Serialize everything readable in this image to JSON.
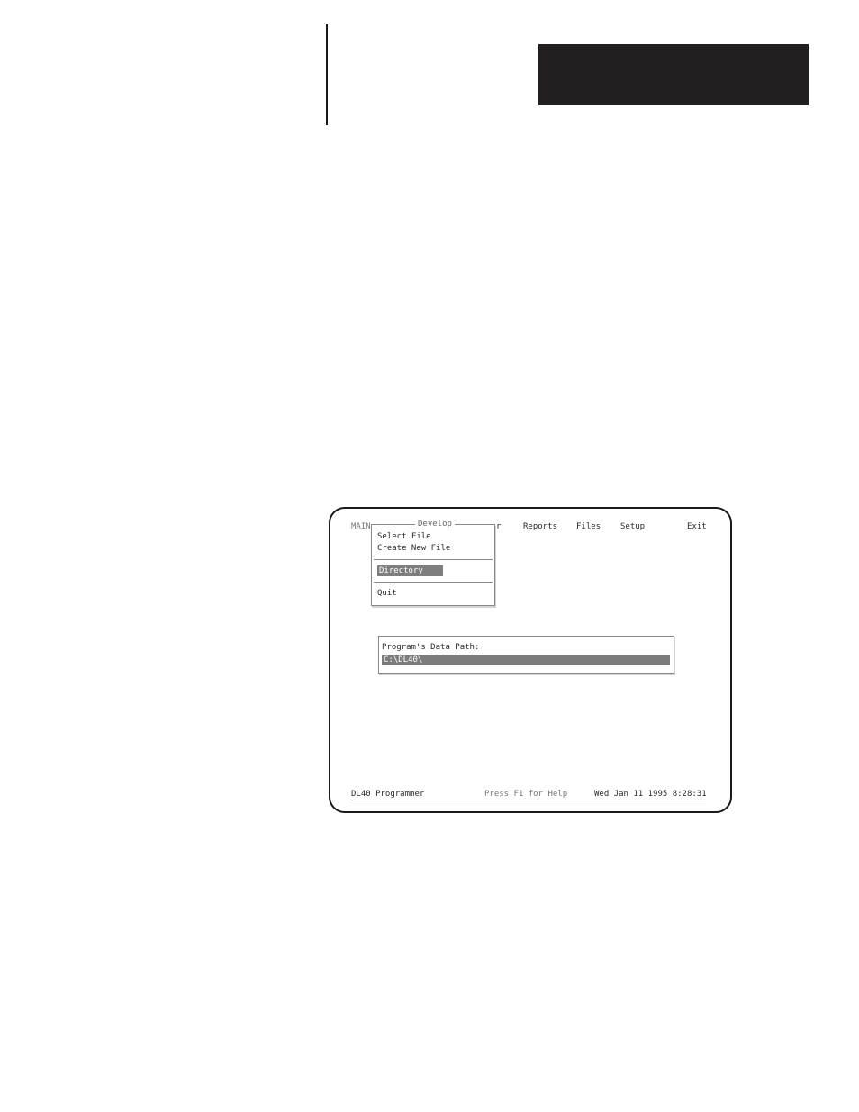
{
  "menu": {
    "main": "MAIN",
    "partial_item": "r",
    "reports": "Reports",
    "files": "Files",
    "setup": "Setup",
    "exit": "Exit"
  },
  "dropdown": {
    "title": "Develop",
    "items": [
      "Select File",
      "Create New File",
      "Directory",
      "Quit"
    ],
    "selected": "Directory"
  },
  "path_dialog": {
    "label": "Program's Data Path:",
    "value": "C:\\DL40\\"
  },
  "status_bar": {
    "app": "DL40 Programmer",
    "help": "Press F1 for Help",
    "datetime": "Wed Jan 11 1995  8:28:31"
  }
}
